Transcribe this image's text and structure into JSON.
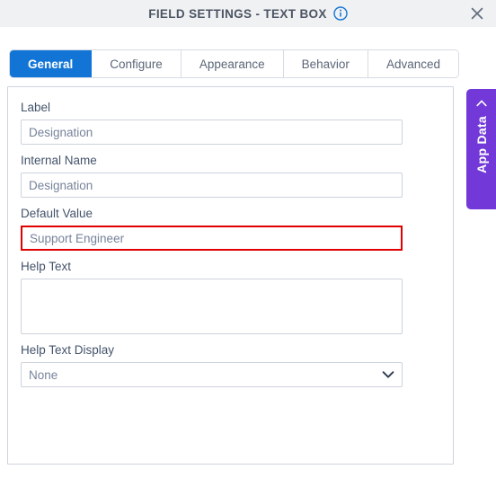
{
  "window": {
    "title": "FIELD SETTINGS - TEXT BOX",
    "info_icon": "info-circle-icon",
    "close_icon": "close-icon"
  },
  "tabs": [
    {
      "label": "General",
      "active": true
    },
    {
      "label": "Configure",
      "active": false
    },
    {
      "label": "Appearance",
      "active": false
    },
    {
      "label": "Behavior",
      "active": false
    },
    {
      "label": "Advanced",
      "active": false
    }
  ],
  "form": {
    "label_field": {
      "label": "Label",
      "value": "Designation",
      "placeholder": "Designation"
    },
    "internal_name_field": {
      "label": "Internal Name",
      "value": "Designation",
      "placeholder": "Designation"
    },
    "default_value_field": {
      "label": "Default Value",
      "value": "Support Engineer",
      "placeholder": "Support Engineer",
      "highlighted": true,
      "highlight_color": "#e00000"
    },
    "help_text_field": {
      "label": "Help Text",
      "value": "",
      "placeholder": ""
    },
    "help_text_display_field": {
      "label": "Help Text Display",
      "selected": "None",
      "options": [
        "None"
      ],
      "chevron_icon": "chevron-down-icon"
    }
  },
  "side_panel": {
    "label": "App Data",
    "collapse_icon": "chevron-left-icon",
    "color": "#7239d8"
  },
  "colors": {
    "accent_blue": "#1275d6",
    "header_bg": "#f0f1f3",
    "purple": "#7239d8",
    "error_red": "#e00000"
  }
}
